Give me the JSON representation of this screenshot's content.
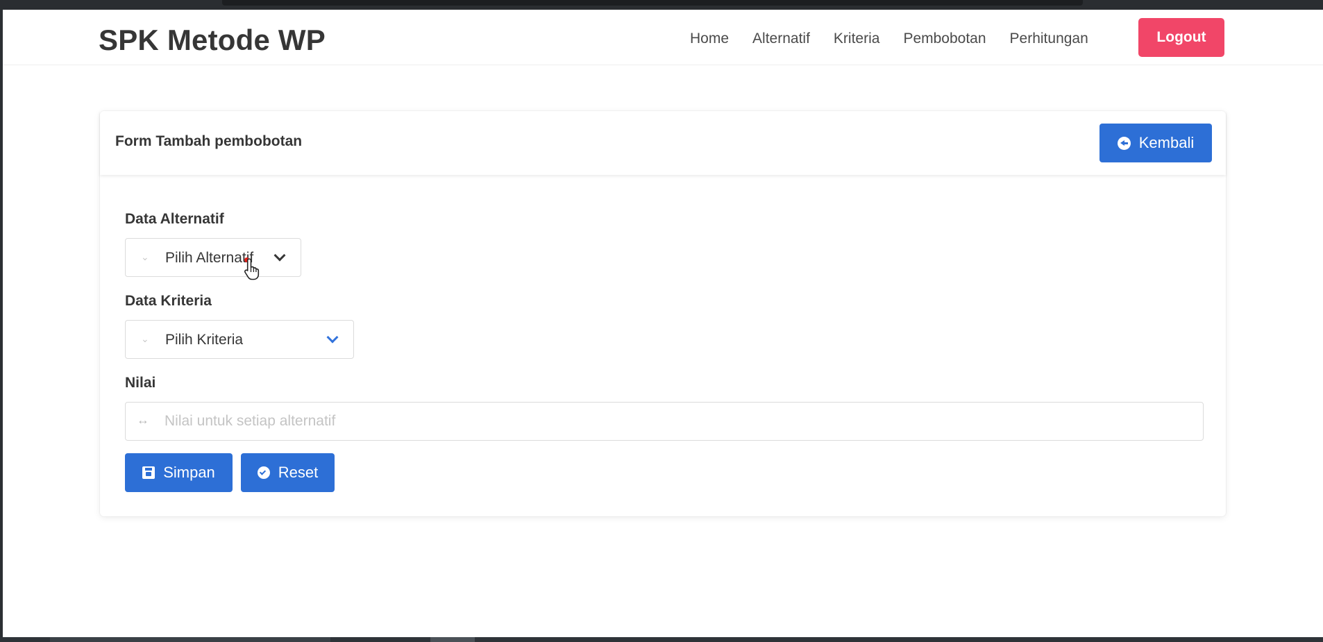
{
  "navbar": {
    "brand": "SPK Metode WP",
    "links": [
      "Home",
      "Alternatif",
      "Kriteria",
      "Pembobotan",
      "Perhitungan"
    ],
    "logout_label": "Logout",
    "logout_color": "#f14668"
  },
  "card": {
    "title": "Form Tambah pembobotan",
    "back_label": "Kembali"
  },
  "form": {
    "alternatif": {
      "label": "Data Alternatif",
      "selected": "Pilih Alternatif"
    },
    "kriteria": {
      "label": "Data Kriteria",
      "selected": "Pilih Kriteria"
    },
    "nilai": {
      "label": "Nilai",
      "placeholder": "Nilai untuk setiap alternatif"
    },
    "save_label": "Simpan",
    "reset_label": "Reset"
  },
  "colors": {
    "primary": "#2d6fd6",
    "danger": "#f14668"
  },
  "icons": [
    "chevron-down-icon",
    "arrows-h-icon",
    "arrow-circle-left-icon",
    "save-icon",
    "check-circle-icon",
    "hand-pointer-icon"
  ]
}
